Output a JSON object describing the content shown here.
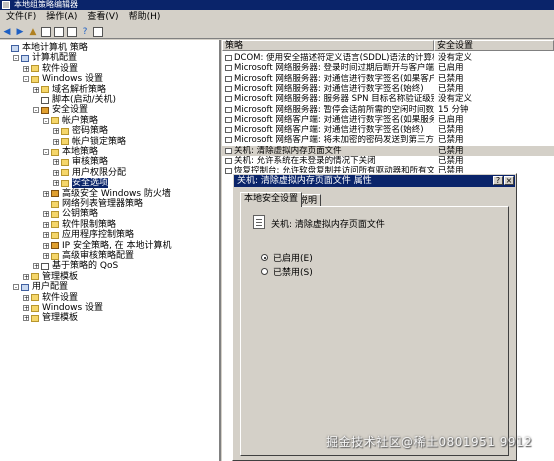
{
  "window": {
    "title": "本地组策略编辑器"
  },
  "menu": [
    "文件(F)",
    "操作(A)",
    "查看(V)",
    "帮助(H)"
  ],
  "toolbar": {
    "icons": [
      "back-icon",
      "forward-icon",
      "up-icon",
      "show-hide-tree-icon",
      "properties-icon",
      "export-icon",
      "help-icon",
      "view-icon"
    ]
  },
  "tree": [
    {
      "label": "本地计算机 策略",
      "indent": 0,
      "exp": "",
      "icon": "comp"
    },
    {
      "label": "计算机配置",
      "indent": 1,
      "exp": "-",
      "icon": "comp"
    },
    {
      "label": "软件设置",
      "indent": 2,
      "exp": "+",
      "icon": "folder"
    },
    {
      "label": "Windows 设置",
      "indent": 2,
      "exp": "-",
      "icon": "folder"
    },
    {
      "label": "域名解析策略",
      "indent": 3,
      "exp": "+",
      "icon": "folder"
    },
    {
      "label": "脚本(启动/关机)",
      "indent": 3,
      "exp": "",
      "icon": "book"
    },
    {
      "label": "安全设置",
      "indent": 3,
      "exp": "-",
      "icon": "shield"
    },
    {
      "label": "帐户策略",
      "indent": 4,
      "exp": "-",
      "icon": "folder"
    },
    {
      "label": "密码策略",
      "indent": 5,
      "exp": "+",
      "icon": "folder"
    },
    {
      "label": "帐户锁定策略",
      "indent": 5,
      "exp": "+",
      "icon": "folder"
    },
    {
      "label": "本地策略",
      "indent": 4,
      "exp": "-",
      "icon": "folder"
    },
    {
      "label": "审核策略",
      "indent": 5,
      "exp": "+",
      "icon": "folder"
    },
    {
      "label": "用户权限分配",
      "indent": 5,
      "exp": "+",
      "icon": "folder"
    },
    {
      "label": "安全选项",
      "indent": 5,
      "exp": "+",
      "icon": "folder",
      "selected": true
    },
    {
      "label": "高级安全 Windows 防火墙",
      "indent": 4,
      "exp": "+",
      "icon": "shield"
    },
    {
      "label": "网络列表管理器策略",
      "indent": 4,
      "exp": "",
      "icon": "folder"
    },
    {
      "label": "公钥策略",
      "indent": 4,
      "exp": "+",
      "icon": "folder"
    },
    {
      "label": "软件限制策略",
      "indent": 4,
      "exp": "+",
      "icon": "folder"
    },
    {
      "label": "应用程序控制策略",
      "indent": 4,
      "exp": "+",
      "icon": "folder"
    },
    {
      "label": "IP 安全策略, 在 本地计算机",
      "indent": 4,
      "exp": "+",
      "icon": "shield"
    },
    {
      "label": "高级审核策略配置",
      "indent": 4,
      "exp": "+",
      "icon": "folder"
    },
    {
      "label": "基于策略的 QoS",
      "indent": 3,
      "exp": "+",
      "icon": "book"
    },
    {
      "label": "管理模板",
      "indent": 2,
      "exp": "+",
      "icon": "folder"
    },
    {
      "label": "用户配置",
      "indent": 1,
      "exp": "-",
      "icon": "comp"
    },
    {
      "label": "软件设置",
      "indent": 2,
      "exp": "+",
      "icon": "folder"
    },
    {
      "label": "Windows 设置",
      "indent": 2,
      "exp": "+",
      "icon": "folder"
    },
    {
      "label": "管理模板",
      "indent": 2,
      "exp": "+",
      "icon": "folder"
    }
  ],
  "list": {
    "col_policy": "策略",
    "col_setting": "安全设置",
    "rows": [
      {
        "name": "DCOM: 使用安全描述符定义语言(SDDL)语法的计算机启动限制",
        "setting": "没有定义"
      },
      {
        "name": "Microsoft 网络服务器: 登录时间过期后断开与客户端的连接",
        "setting": "已启用"
      },
      {
        "name": "Microsoft 网络服务器: 对通信进行数字签名(如果客户端...",
        "setting": "已禁用"
      },
      {
        "name": "Microsoft 网络服务器: 对通信进行数字签名(始终)",
        "setting": "已禁用"
      },
      {
        "name": "Microsoft 网络服务器: 服务器 SPN 目标名称验证级别",
        "setting": "没有定义"
      },
      {
        "name": "Microsoft 网络服务器: 暂停会话前所需的空闲时间数量",
        "setting": "15 分钟"
      },
      {
        "name": "Microsoft 网络客户端: 对通信进行数字签名(如果服务器...",
        "setting": "已启用"
      },
      {
        "name": "Microsoft 网络客户端: 对通信进行数字签名(始终)",
        "setting": "已禁用"
      },
      {
        "name": "Microsoft 网络客户端: 将未加密的密码发送到第三方 SM...",
        "setting": "已禁用"
      },
      {
        "name": "关机: 清除虚拟内存页面文件",
        "setting": "已禁用",
        "highlight": true
      },
      {
        "name": "关机: 允许系统在未登录的情况下关闭",
        "setting": "已禁用"
      },
      {
        "name": "恢复控制台: 允许软盘复制并访问所有驱动器和所有文件夹",
        "setting": "已禁用"
      }
    ]
  },
  "dialog": {
    "title": "关机: 清除虚拟内存页面文件 属性",
    "help_btn": "?",
    "close_btn": "×",
    "tabs": [
      "本地安全设置",
      "说明"
    ],
    "policy_name": "关机: 清除虚拟内存页面文件",
    "options": [
      {
        "label": "已启用(E)",
        "checked": true
      },
      {
        "label": "已禁用(S)",
        "checked": false
      }
    ]
  },
  "watermark": "掘金技术社区@稀土0801951 9912"
}
